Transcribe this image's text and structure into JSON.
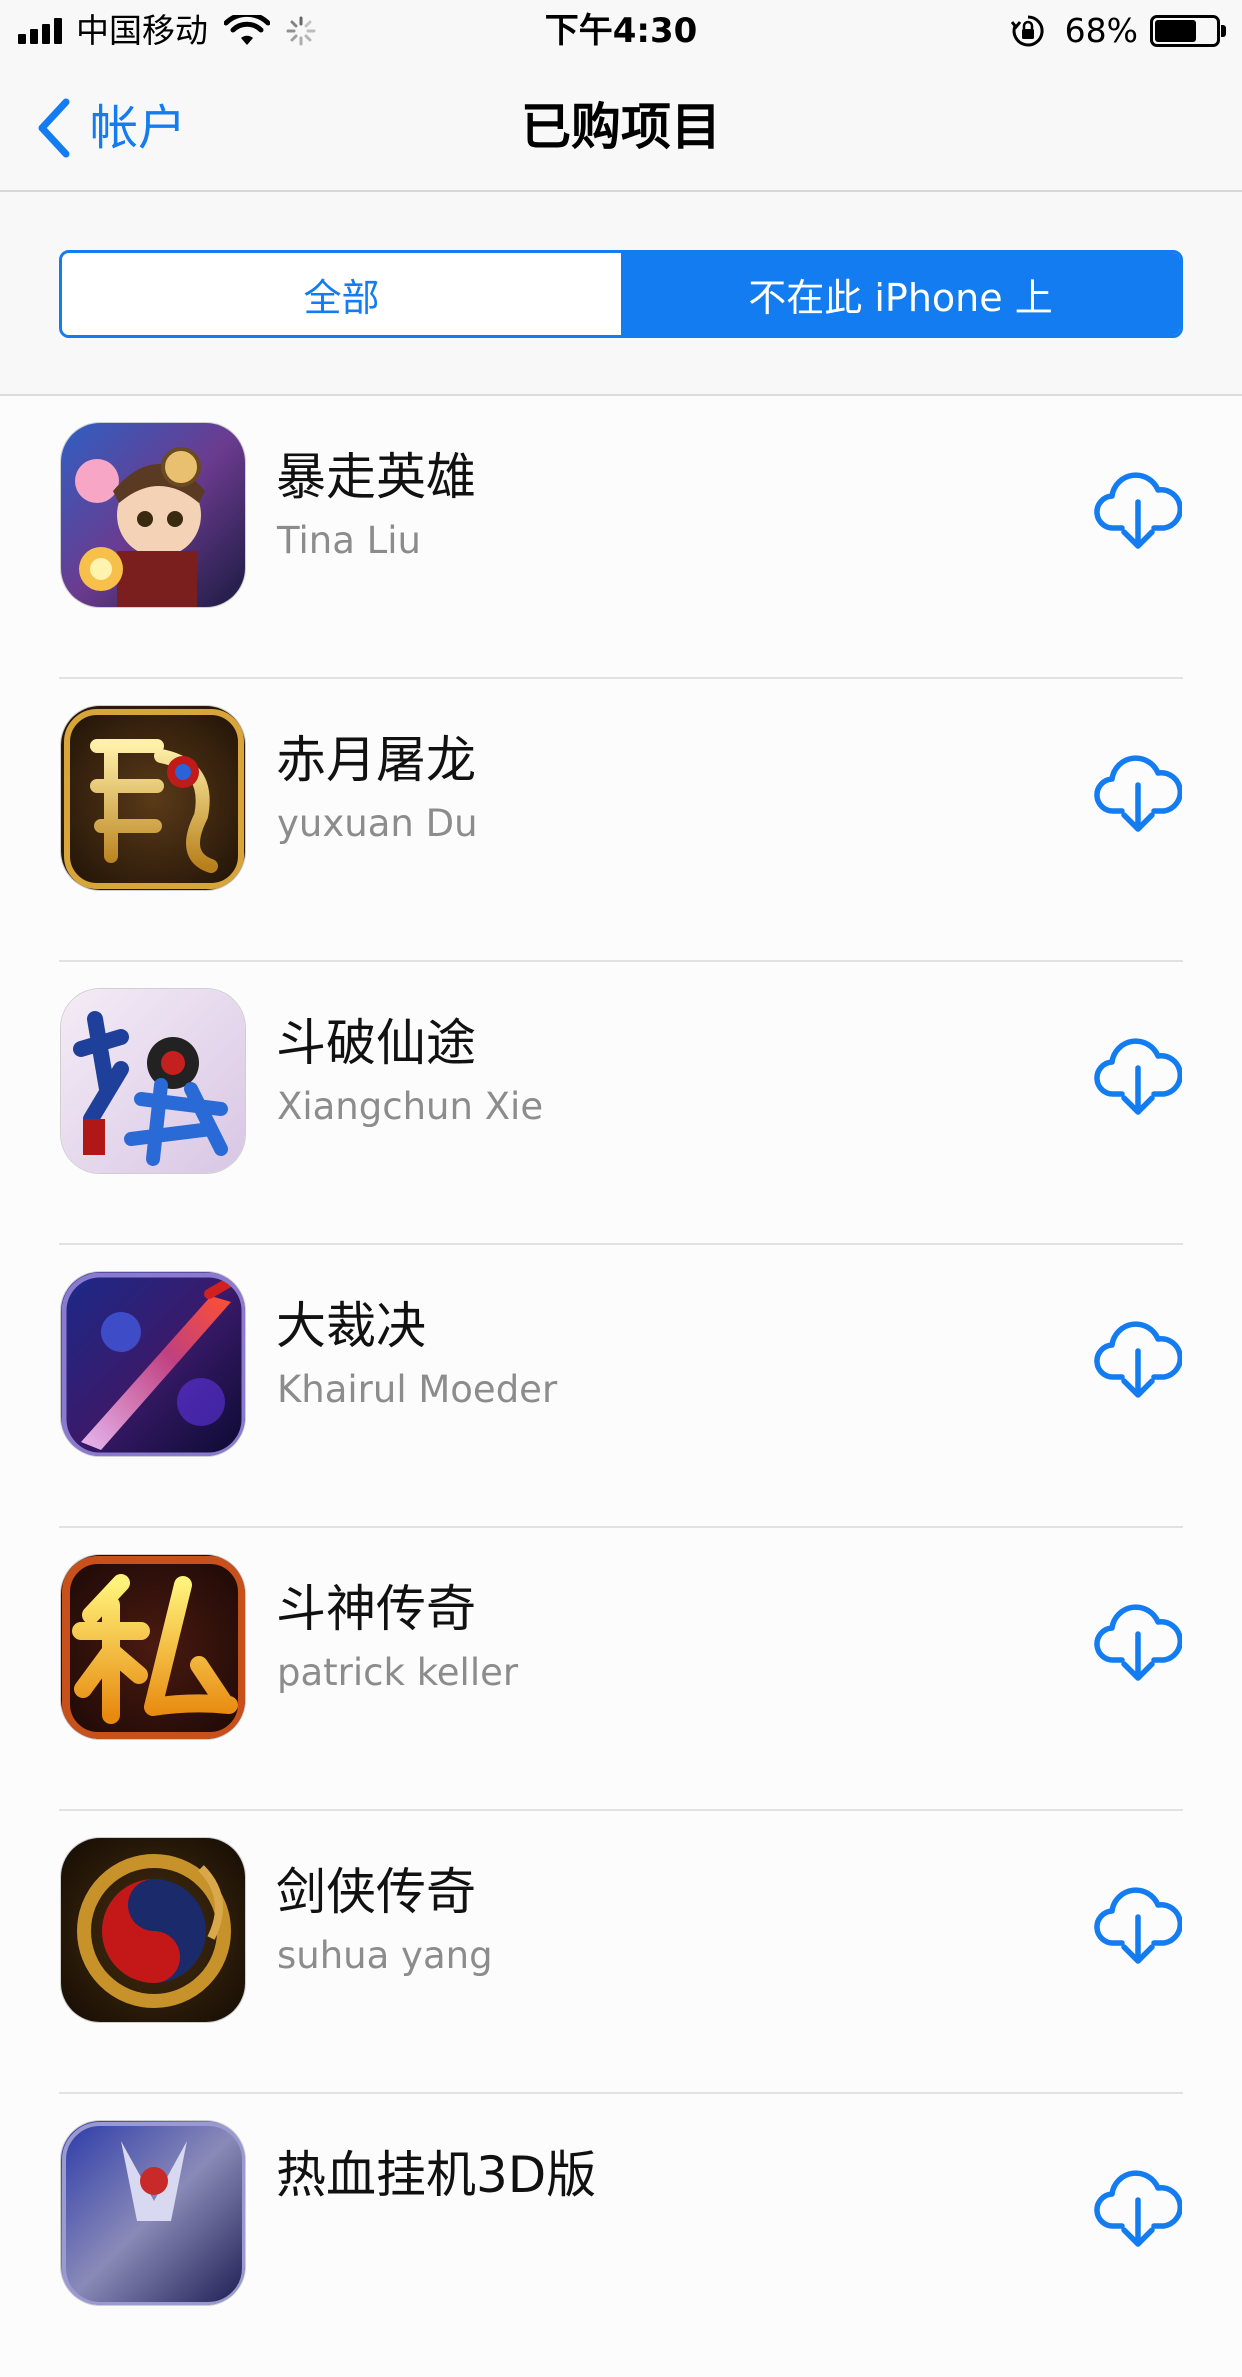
{
  "status_bar": {
    "carrier": "中国移动",
    "time": "下午4:30",
    "battery_percent": "68%",
    "battery_level": 0.68,
    "icons": [
      "signal-icon",
      "wifi-icon",
      "activity-spinner-icon",
      "orientation-lock-icon",
      "battery-icon"
    ]
  },
  "nav": {
    "back_label": "帐户",
    "title": "已购项目"
  },
  "segments": {
    "all_label": "全部",
    "not_on_device_label": "不在此 iPhone 上",
    "selected": "not_on_device"
  },
  "apps": [
    {
      "name": "暴走英雄",
      "developer": "Tina Liu",
      "icon": "bao-zou-ying-xiong-app-icon"
    },
    {
      "name": "赤月屠龙",
      "developer": "yuxuan Du",
      "icon": "chi-yue-tu-long-app-icon"
    },
    {
      "name": "斗破仙途",
      "developer": "Xiangchun Xie",
      "icon": "dou-po-xian-tu-app-icon"
    },
    {
      "name": "大裁决",
      "developer": "Khairul Moeder",
      "icon": "da-cai-jue-app-icon"
    },
    {
      "name": "斗神传奇",
      "developer": "patrick keller",
      "icon": "dou-shen-chuan-qi-app-icon"
    },
    {
      "name": "剑侠传奇",
      "developer": "suhua yang",
      "icon": "jian-xia-chuan-qi-app-icon"
    },
    {
      "name": "热血挂机3D版",
      "developer": "",
      "icon": "re-xue-gua-ji-app-icon"
    }
  ],
  "colors": {
    "accent": "#127cf0",
    "secondary_text": "#8c8c8c"
  }
}
